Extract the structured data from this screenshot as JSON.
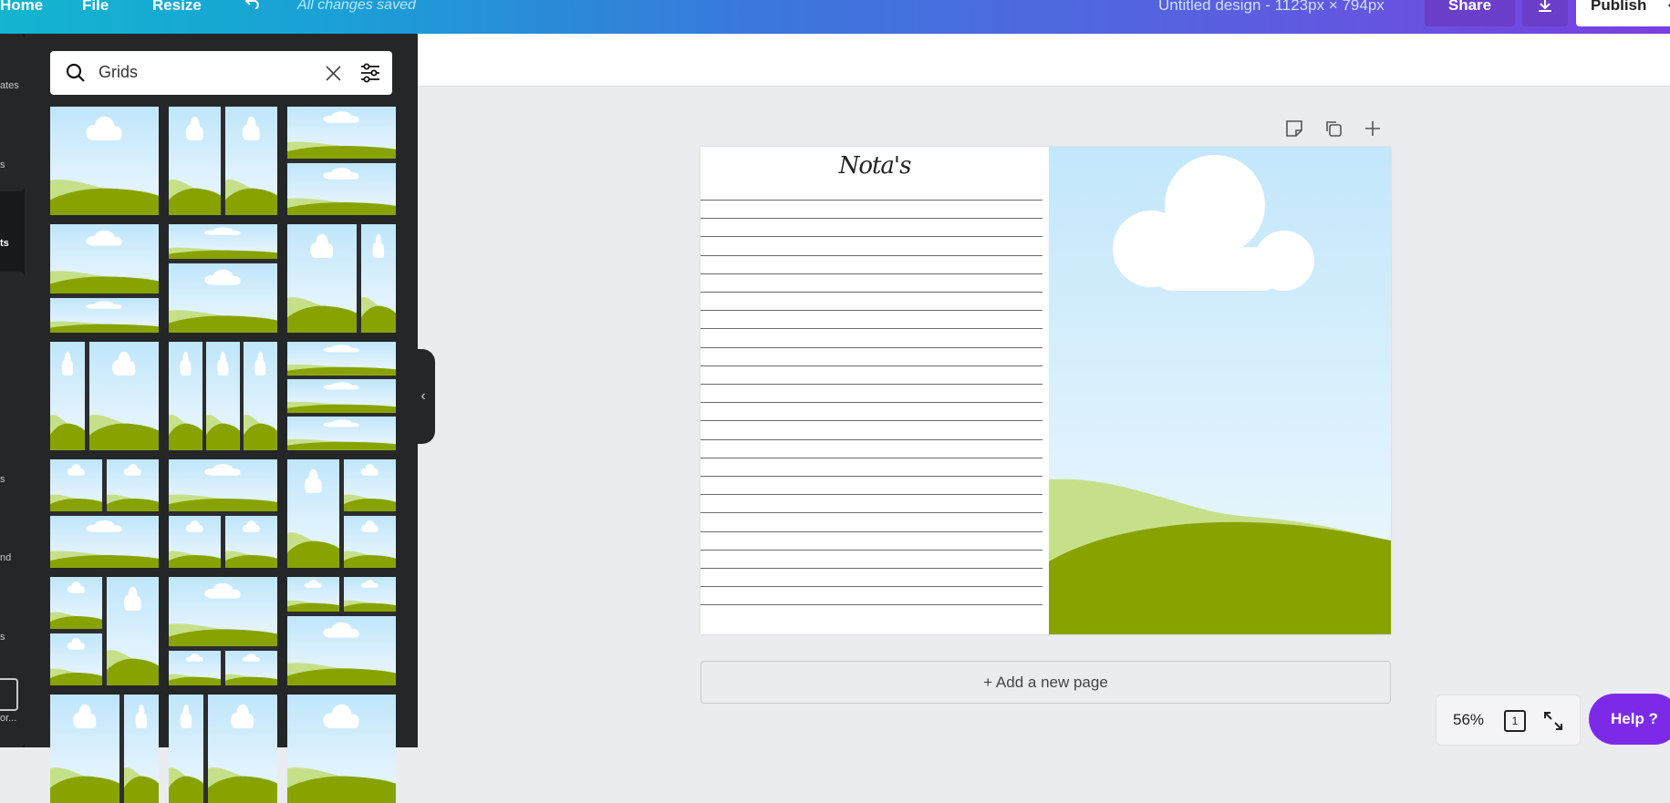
{
  "topbar": {
    "home": "Home",
    "file": "File",
    "resize": "Resize",
    "saved_status": "All changes saved",
    "design_title": "Untitled design - 1123px × 794px",
    "share": "Share",
    "publish": "Publish"
  },
  "rail": {
    "labels": [
      "ates",
      "s",
      "ts",
      "s",
      "nd",
      "s",
      "or..."
    ]
  },
  "search": {
    "query": "Grids"
  },
  "page": {
    "notes_title": "Nota's"
  },
  "canvas": {
    "add_page": "+ Add a new page"
  },
  "footer": {
    "zoom": "56%",
    "page_count": "1",
    "help": "Help ?"
  }
}
